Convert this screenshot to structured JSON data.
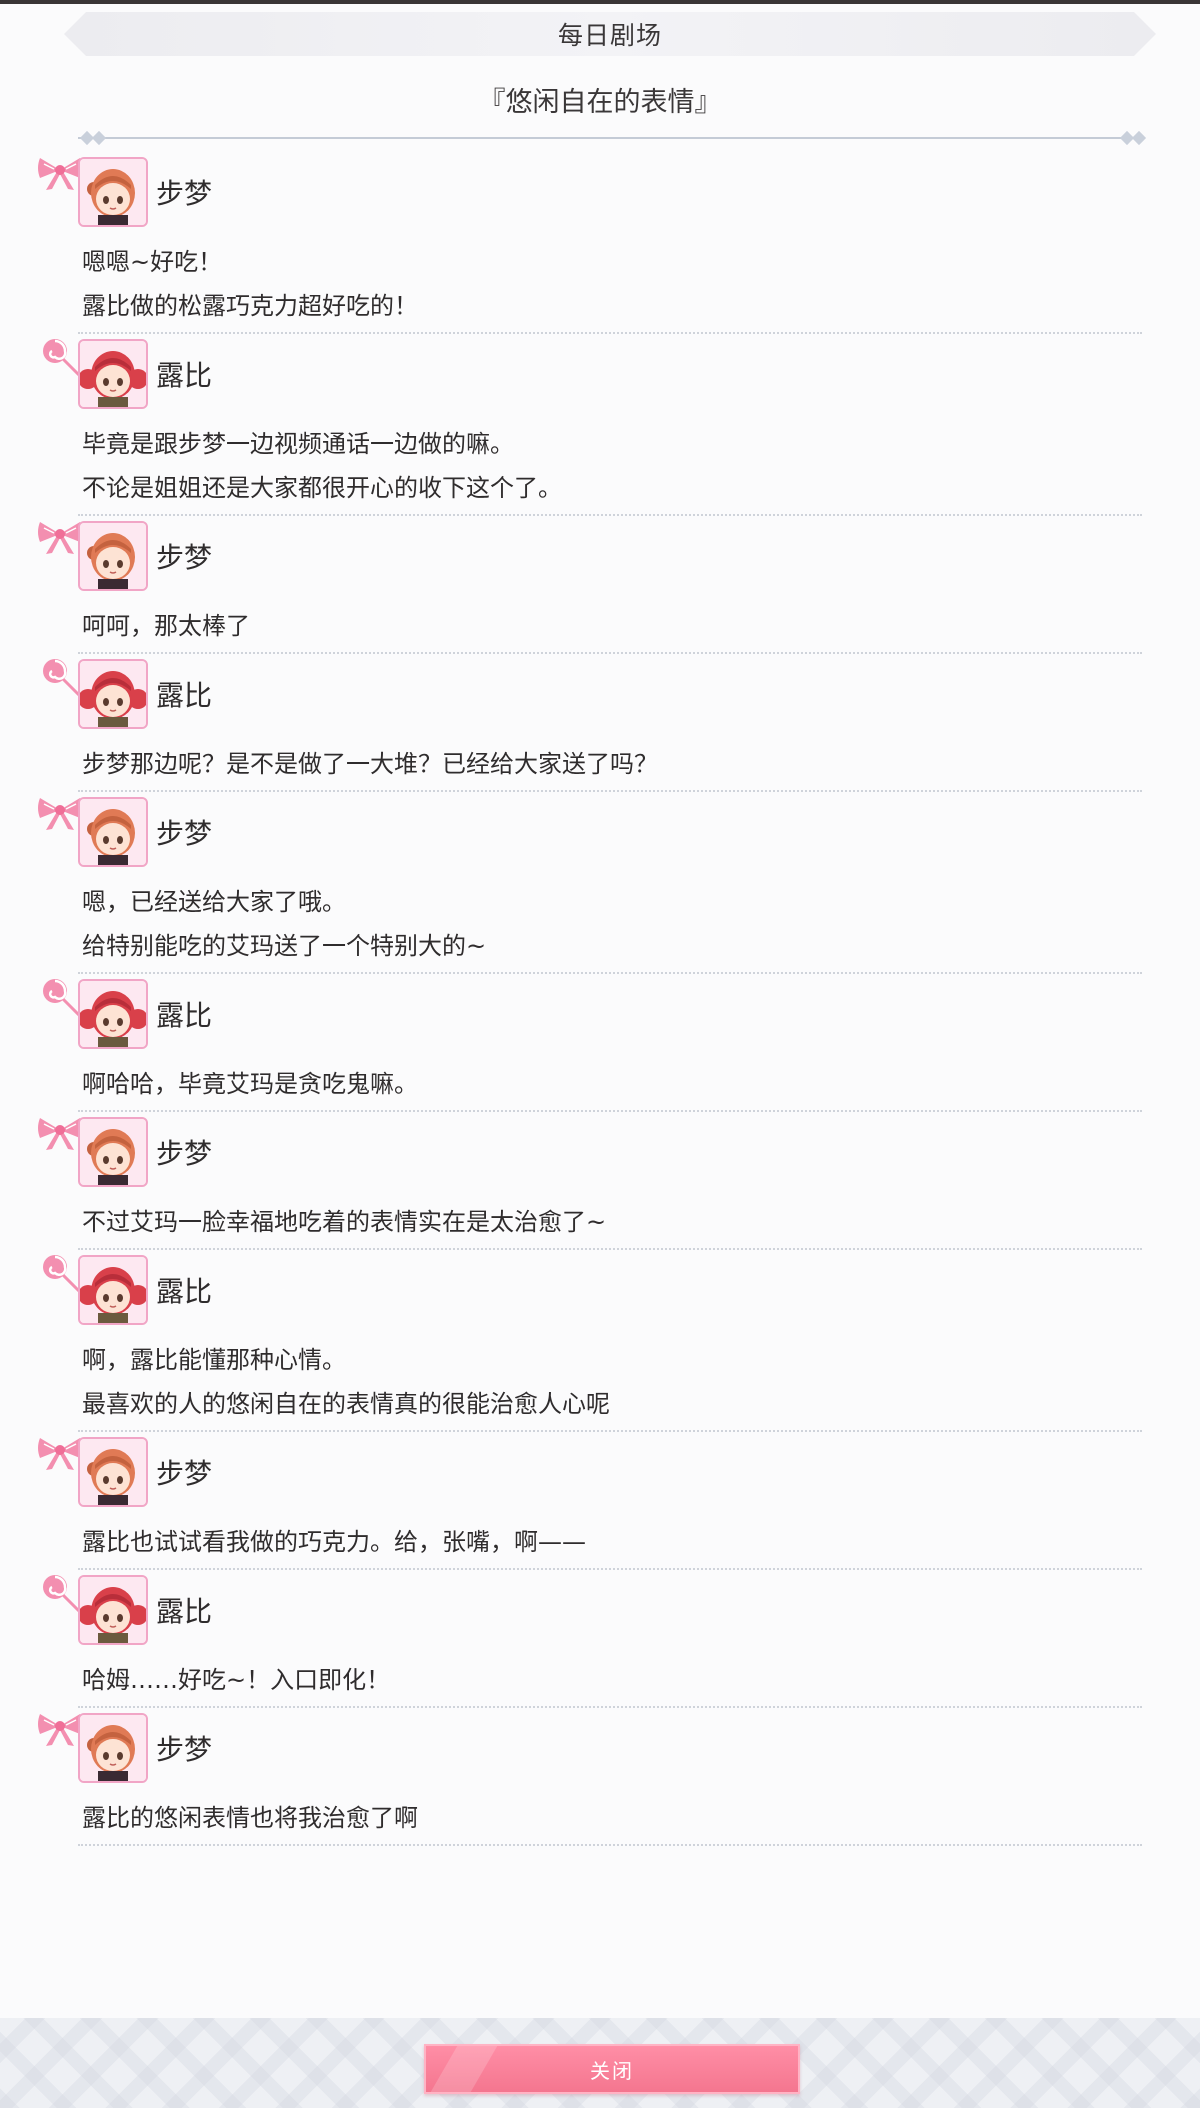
{
  "header": {
    "title": "每日剧场",
    "subtitle": "『悠闲自在的表情』"
  },
  "colors": {
    "accent_pink": "#f4768f",
    "avatar_border": "#f1a5c6",
    "ribbon_pink": "#f38fb0"
  },
  "entries": [
    {
      "speaker": "步梦",
      "character": "ayumu",
      "lines": [
        "嗯嗯~好吃！",
        "露比做的松露巧克力超好吃的！"
      ]
    },
    {
      "speaker": "露比",
      "character": "ruby",
      "lines": [
        "毕竟是跟步梦一边视频通话一边做的嘛。",
        "不论是姐姐还是大家都很开心的收下这个了。"
      ]
    },
    {
      "speaker": "步梦",
      "character": "ayumu",
      "lines": [
        "呵呵，那太棒了"
      ]
    },
    {
      "speaker": "露比",
      "character": "ruby",
      "lines": [
        "步梦那边呢？是不是做了一大堆？已经给大家送了吗？"
      ]
    },
    {
      "speaker": "步梦",
      "character": "ayumu",
      "lines": [
        "嗯，已经送给大家了哦。",
        "给特别能吃的艾玛送了一个特别大的~"
      ]
    },
    {
      "speaker": "露比",
      "character": "ruby",
      "lines": [
        "啊哈哈，毕竟艾玛是贪吃鬼嘛。"
      ]
    },
    {
      "speaker": "步梦",
      "character": "ayumu",
      "lines": [
        "不过艾玛一脸幸福地吃着的表情实在是太治愈了~"
      ]
    },
    {
      "speaker": "露比",
      "character": "ruby",
      "lines": [
        "啊，露比能懂那种心情。",
        "最喜欢的人的悠闲自在的表情真的很能治愈人心呢"
      ]
    },
    {
      "speaker": "步梦",
      "character": "ayumu",
      "lines": [
        "露比也试试看我做的巧克力。给，张嘴，啊——"
      ]
    },
    {
      "speaker": "露比",
      "character": "ruby",
      "lines": [
        "哈姆……好吃~！入口即化！"
      ]
    },
    {
      "speaker": "步梦",
      "character": "ayumu",
      "lines": [
        "露比的悠闲表情也将我治愈了啊"
      ]
    }
  ],
  "footer": {
    "close_label": "关闭"
  }
}
